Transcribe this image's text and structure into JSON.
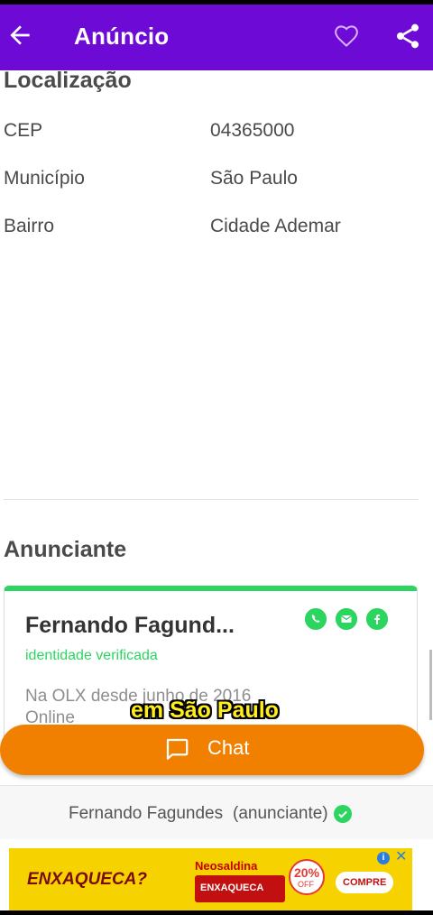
{
  "appbar": {
    "title": "Anúncio"
  },
  "location": {
    "title": "Localização",
    "rows": [
      {
        "label": "CEP",
        "value": "04365000"
      },
      {
        "label": "Município",
        "value": "São Paulo"
      },
      {
        "label": "Bairro",
        "value": "Cidade Ademar"
      }
    ]
  },
  "advertiser": {
    "title": "Anunciante",
    "name": "Fernando Fagund...",
    "verified": "identidade verificada",
    "since": "Na OLX desde junho de 2016",
    "online": "Online"
  },
  "caption": "em São Paulo",
  "chat": {
    "label": "Chat"
  },
  "seller_bar": {
    "name": "Fernando Fagundes",
    "role": "(anunciante)"
  },
  "ad": {
    "headline": "ENXAQUECA?",
    "brand": "Neosaldina",
    "pack": "ENXAQUECA",
    "badge_pct": "20%",
    "badge_off": "OFF",
    "cta": "COMPRE"
  },
  "colors": {
    "primary": "#6e0ad6",
    "accent": "#f28000",
    "success": "#2bd560"
  },
  "icons": [
    "back-arrow-icon",
    "heart-icon",
    "share-icon",
    "whatsapp-icon",
    "mail-icon",
    "facebook-icon",
    "chat-bubble-icon",
    "check-circle-icon"
  ]
}
